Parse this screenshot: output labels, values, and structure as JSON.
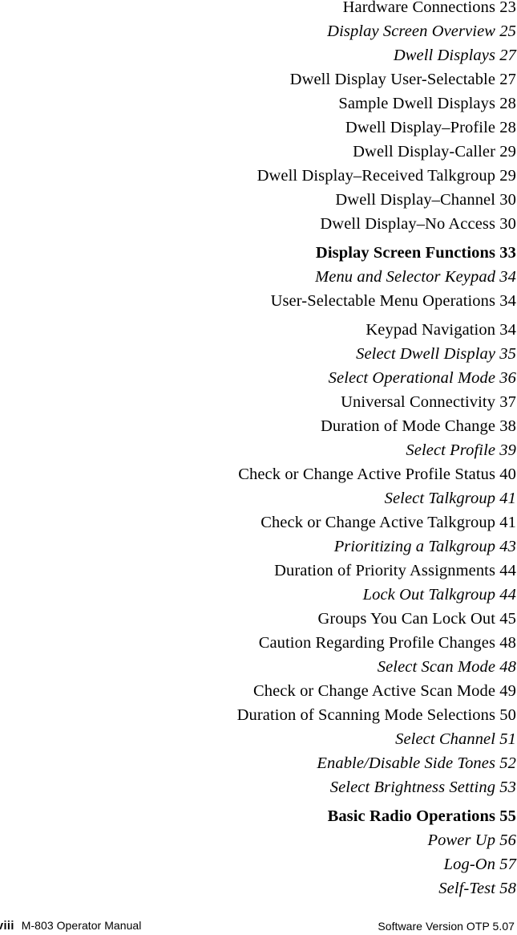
{
  "document": {
    "type": "table-of-contents",
    "page_folio": "viii",
    "text_color": "#000000",
    "background_color": "#ffffff"
  },
  "toc": {
    "entries": [
      {
        "title": "Hardware Connections",
        "page": "23",
        "level": "item",
        "gap_before": false
      },
      {
        "title": "Display Screen Overview",
        "page": "25",
        "level": "sub",
        "gap_before": false
      },
      {
        "title": "Dwell Displays",
        "page": "27",
        "level": "sub",
        "gap_before": false
      },
      {
        "title": "Dwell Display User-Selectable",
        "page": "27",
        "level": "item",
        "gap_before": false
      },
      {
        "title": "Sample Dwell Displays",
        "page": "28",
        "level": "item",
        "gap_before": false
      },
      {
        "title": "Dwell Display–Profile",
        "page": "28",
        "level": "item",
        "gap_before": false
      },
      {
        "title": "Dwell Display-Caller",
        "page": "29",
        "level": "item",
        "gap_before": false
      },
      {
        "title": "Dwell Display–Received Talkgroup",
        "page": "29",
        "level": "item",
        "gap_before": false
      },
      {
        "title": "Dwell Display–Channel",
        "page": "30",
        "level": "item",
        "gap_before": false
      },
      {
        "title": "Dwell Display–No Access",
        "page": "30",
        "level": "item",
        "gap_before": false
      },
      {
        "title": "Display Screen Functions",
        "page": "33",
        "level": "head",
        "gap_before": true
      },
      {
        "title": "Menu and Selector Keypad",
        "page": "34",
        "level": "sub",
        "gap_before": false
      },
      {
        "title": "User-Selectable Menu Operations",
        "page": "34",
        "level": "item",
        "gap_before": false
      },
      {
        "title": "Keypad Navigation",
        "page": "34",
        "level": "item",
        "gap_before": true
      },
      {
        "title": "Select Dwell Display",
        "page": "35",
        "level": "sub",
        "gap_before": false
      },
      {
        "title": "Select Operational Mode",
        "page": "36",
        "level": "sub",
        "gap_before": false
      },
      {
        "title": "Universal Connectivity",
        "page": "37",
        "level": "item",
        "gap_before": false
      },
      {
        "title": "Duration of Mode Change",
        "page": "38",
        "level": "item",
        "gap_before": false
      },
      {
        "title": "Select Profile",
        "page": "39",
        "level": "sub",
        "gap_before": false
      },
      {
        "title": "Check or Change Active Profile Status",
        "page": "40",
        "level": "item",
        "gap_before": false
      },
      {
        "title": "Select Talkgroup",
        "page": "41",
        "level": "sub",
        "gap_before": false
      },
      {
        "title": "Check or Change Active Talkgroup",
        "page": "41",
        "level": "item",
        "gap_before": false
      },
      {
        "title": "Prioritizing a Talkgroup",
        "page": "43",
        "level": "sub",
        "gap_before": false
      },
      {
        "title": "Duration of Priority Assignments",
        "page": "44",
        "level": "item",
        "gap_before": false
      },
      {
        "title": "Lock Out Talkgroup",
        "page": "44",
        "level": "sub",
        "gap_before": false
      },
      {
        "title": "Groups You Can Lock Out",
        "page": "45",
        "level": "item",
        "gap_before": false
      },
      {
        "title": "Caution Regarding Profile Changes",
        "page": "48",
        "level": "item",
        "gap_before": false
      },
      {
        "title": "Select Scan Mode",
        "page": "48",
        "level": "sub",
        "gap_before": false
      },
      {
        "title": "Check or Change Active Scan Mode",
        "page": "49",
        "level": "item",
        "gap_before": false
      },
      {
        "title": "Duration of Scanning Mode Selections",
        "page": "50",
        "level": "item",
        "gap_before": false
      },
      {
        "title": "Select Channel",
        "page": "51",
        "level": "sub",
        "gap_before": false
      },
      {
        "title": "Enable/Disable Side Tones",
        "page": "52",
        "level": "sub",
        "gap_before": false
      },
      {
        "title": "Select Brightness Setting",
        "page": "53",
        "level": "sub",
        "gap_before": false
      },
      {
        "title": "Basic Radio Operations",
        "page": "55",
        "level": "head",
        "gap_before": true
      },
      {
        "title": "Power Up",
        "page": "56",
        "level": "sub",
        "gap_before": false
      },
      {
        "title": "Log-On",
        "page": "57",
        "level": "sub",
        "gap_before": false
      },
      {
        "title": "Self-Test",
        "page": "58",
        "level": "sub",
        "gap_before": false
      }
    ]
  },
  "footer": {
    "folio": "viii",
    "manual_title": "M-803 Operator Manual",
    "software_version": "Software Version OTP 5.07"
  }
}
